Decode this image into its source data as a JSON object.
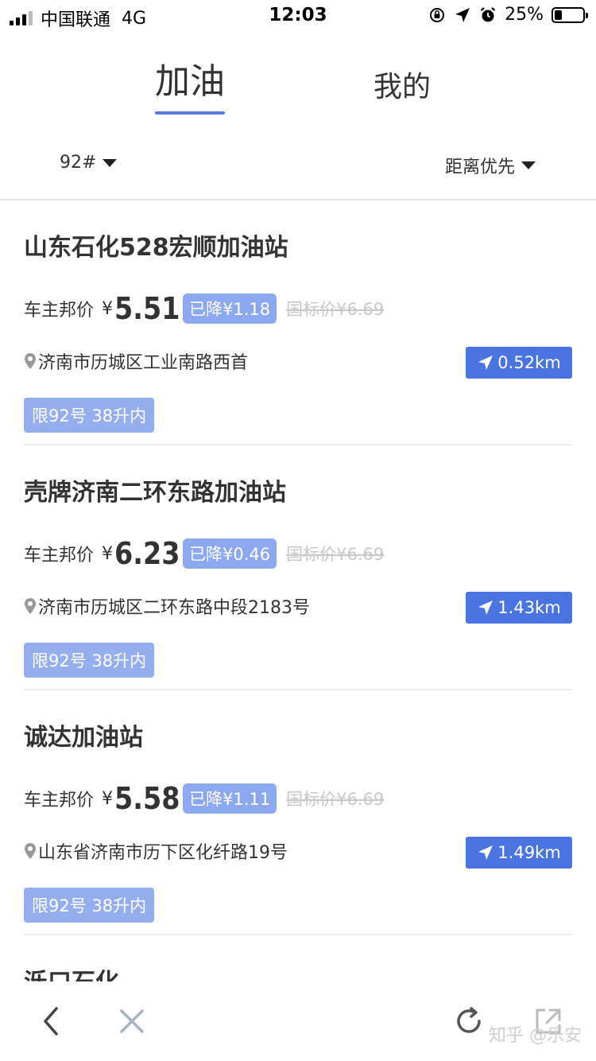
{
  "status_bar": {
    "carrier": "中国联通",
    "network": "4G",
    "time": "12:03",
    "battery": "25%",
    "battery_level": 0.25
  },
  "tabs": [
    {
      "label": "加油",
      "active": true
    },
    {
      "label": "我的",
      "active": false
    }
  ],
  "filters": {
    "grade": "92#",
    "sort": "距离优先"
  },
  "stations": [
    {
      "name": "山东石化528宏顺加油站",
      "price_label": "车主邦价",
      "currency": "¥",
      "price": "5.51",
      "discount": "已降¥1.18",
      "standard_price": "国标价¥6.69",
      "address": "济南市历城区工业南路西首",
      "distance": "0.52km",
      "limit": "限92号 38升内"
    },
    {
      "name": "壳牌济南二环东路加油站",
      "price_label": "车主邦价",
      "currency": "¥",
      "price": "6.23",
      "discount": "已降¥0.46",
      "standard_price": "国标价¥6.69",
      "address": "济南市历城区二环东路中段2183号",
      "distance": "1.43km",
      "limit": "限92号 38升内"
    },
    {
      "name": "诚达加油站",
      "price_label": "车主邦价",
      "currency": "¥",
      "price": "5.58",
      "discount": "已降¥1.11",
      "standard_price": "国标价¥6.69",
      "address": "山东省济南市历下区化纤路19号",
      "distance": "1.49km",
      "limit": "限92号 38升内"
    }
  ],
  "next_station_partial": "泺口石化",
  "watermark": "知乎 @乐安",
  "colors": {
    "accent": "#4a74e0",
    "tag": "#95afee",
    "discount": "#8ca8ee"
  },
  "icons": {
    "back": "chevron-left-icon",
    "close": "close-icon",
    "refresh": "refresh-icon",
    "share": "share-icon"
  }
}
